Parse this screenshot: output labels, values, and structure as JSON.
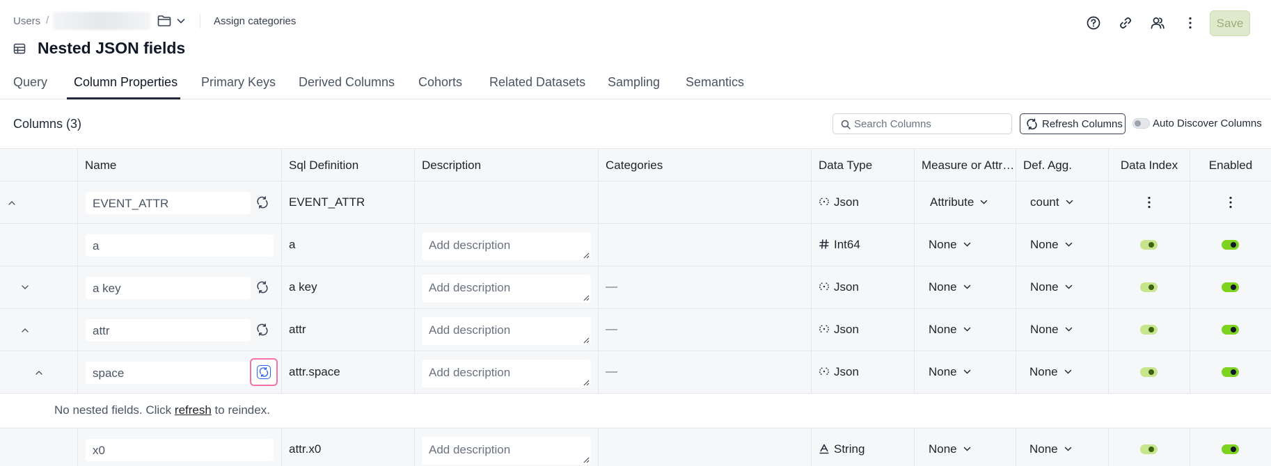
{
  "breadcrumb": {
    "root": "Users",
    "separator": "/"
  },
  "header": {
    "assign_categories": "Assign categories",
    "save_label": "Save",
    "title": "Nested JSON fields",
    "action_icons": [
      "help-icon",
      "link-icon",
      "users-icon",
      "more-vertical-icon"
    ]
  },
  "tabs": [
    {
      "label": "Query",
      "active": false
    },
    {
      "label": "Column Properties",
      "active": true
    },
    {
      "label": "Primary Keys",
      "active": false
    },
    {
      "label": "Derived Columns",
      "active": false
    },
    {
      "label": "Cohorts",
      "active": false
    },
    {
      "label": "Related Datasets",
      "active": false
    },
    {
      "label": "Sampling",
      "active": false
    },
    {
      "label": "Semantics",
      "active": false
    }
  ],
  "toolbar": {
    "columns_title": "Columns (3)",
    "search_placeholder": "Search Columns",
    "refresh_label": "Refresh Columns",
    "auto_discover_label": "Auto Discover Columns",
    "auto_discover_on": false
  },
  "table": {
    "headers": {
      "name": "Name",
      "sql": "Sql Definition",
      "description": "Description",
      "categories": "Categories",
      "data_type": "Data Type",
      "measure": "Measure or Attribute",
      "agg": "Def. Agg.",
      "data_index": "Data Index",
      "enabled": "Enabled"
    },
    "description_placeholder": "Add description",
    "empty_categories": "—",
    "rows": [
      {
        "name": "EVENT_ATTR",
        "sql": "EVENT_ATTR",
        "data_type": "Json",
        "measure": "Attribute",
        "agg": "count"
      },
      {
        "name": "a",
        "sql": "a",
        "data_type": "Int64",
        "measure": "None",
        "agg": "None",
        "data_index": true,
        "enabled": true
      },
      {
        "name": "a key",
        "sql": "a key",
        "data_type": "Json",
        "measure": "None",
        "agg": "None",
        "data_index": true,
        "enabled": true
      },
      {
        "name": "attr",
        "sql": "attr",
        "data_type": "Json",
        "measure": "None",
        "agg": "None",
        "data_index": true,
        "enabled": true
      },
      {
        "name": "space",
        "sql": "attr.space",
        "data_type": "Json",
        "measure": "None",
        "agg": "None",
        "data_index": true,
        "enabled": true
      },
      {
        "name": "x0",
        "sql": "attr.x0",
        "data_type": "String",
        "measure": "None",
        "agg": "None",
        "data_index": true,
        "enabled": true
      }
    ],
    "nested_message": {
      "prefix": "No nested fields. Click ",
      "link": "refresh",
      "suffix": " to reindex."
    }
  },
  "colors": {
    "accent_green": "#7ed321",
    "save_bg": "#dfeacd",
    "highlight_pink": "#f472a8",
    "focus_blue": "#2563eb"
  }
}
